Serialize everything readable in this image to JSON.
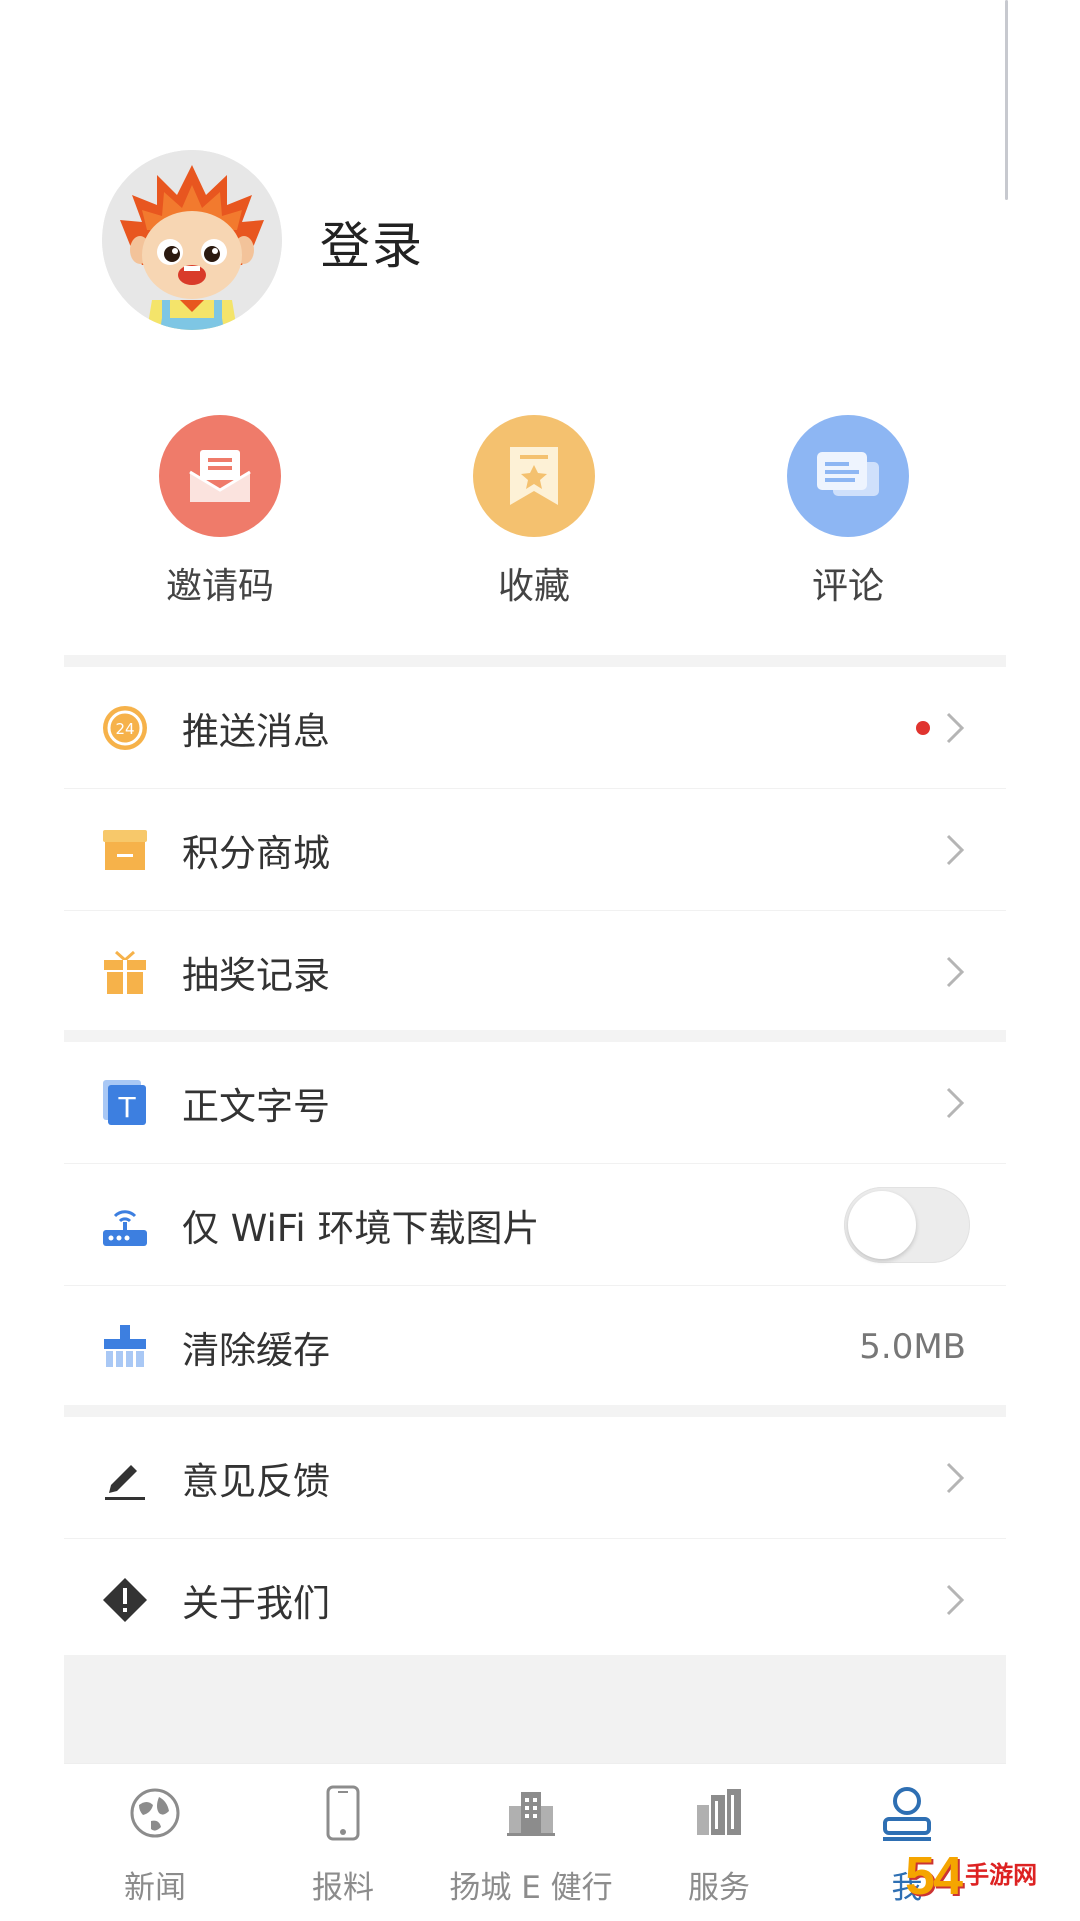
{
  "profile": {
    "login_label": "登录"
  },
  "quick_actions": [
    {
      "label": "邀请码",
      "icon": "invite-envelope-icon",
      "color": "#ef7b6a"
    },
    {
      "label": "收藏",
      "icon": "bookmark-icon",
      "color": "#f4c16f"
    },
    {
      "label": "评论",
      "icon": "comment-icon",
      "color": "#8db6f3"
    }
  ],
  "group1": [
    {
      "label": "推送消息",
      "icon": "clock-24-icon",
      "has_dot": true
    },
    {
      "label": "积分商城",
      "icon": "store-icon"
    },
    {
      "label": "抽奖记录",
      "icon": "gift-icon"
    }
  ],
  "group2": [
    {
      "label": "正文字号",
      "icon": "font-size-icon"
    },
    {
      "label": "仅 WiFi 环境下载图片",
      "icon": "router-icon",
      "toggle_on": false
    },
    {
      "label": "清除缓存",
      "icon": "broom-icon",
      "value": "5.0MB"
    }
  ],
  "group3": [
    {
      "label": "意见反馈",
      "icon": "pencil-icon"
    },
    {
      "label": "关于我们",
      "icon": "info-diamond-icon"
    }
  ],
  "tabs": [
    {
      "label": "新闻",
      "icon": "globe-icon"
    },
    {
      "label": "报料",
      "icon": "phone-icon"
    },
    {
      "label": "扬城 E 健行",
      "icon": "building-icon"
    },
    {
      "label": "服务",
      "icon": "city-icon"
    },
    {
      "label": "我",
      "icon": "user-icon",
      "active": true
    }
  ],
  "watermark": {
    "number": "54",
    "site": "手游网"
  },
  "colors": {
    "accent": "#2e6fb3",
    "dot": "#e0342f"
  }
}
